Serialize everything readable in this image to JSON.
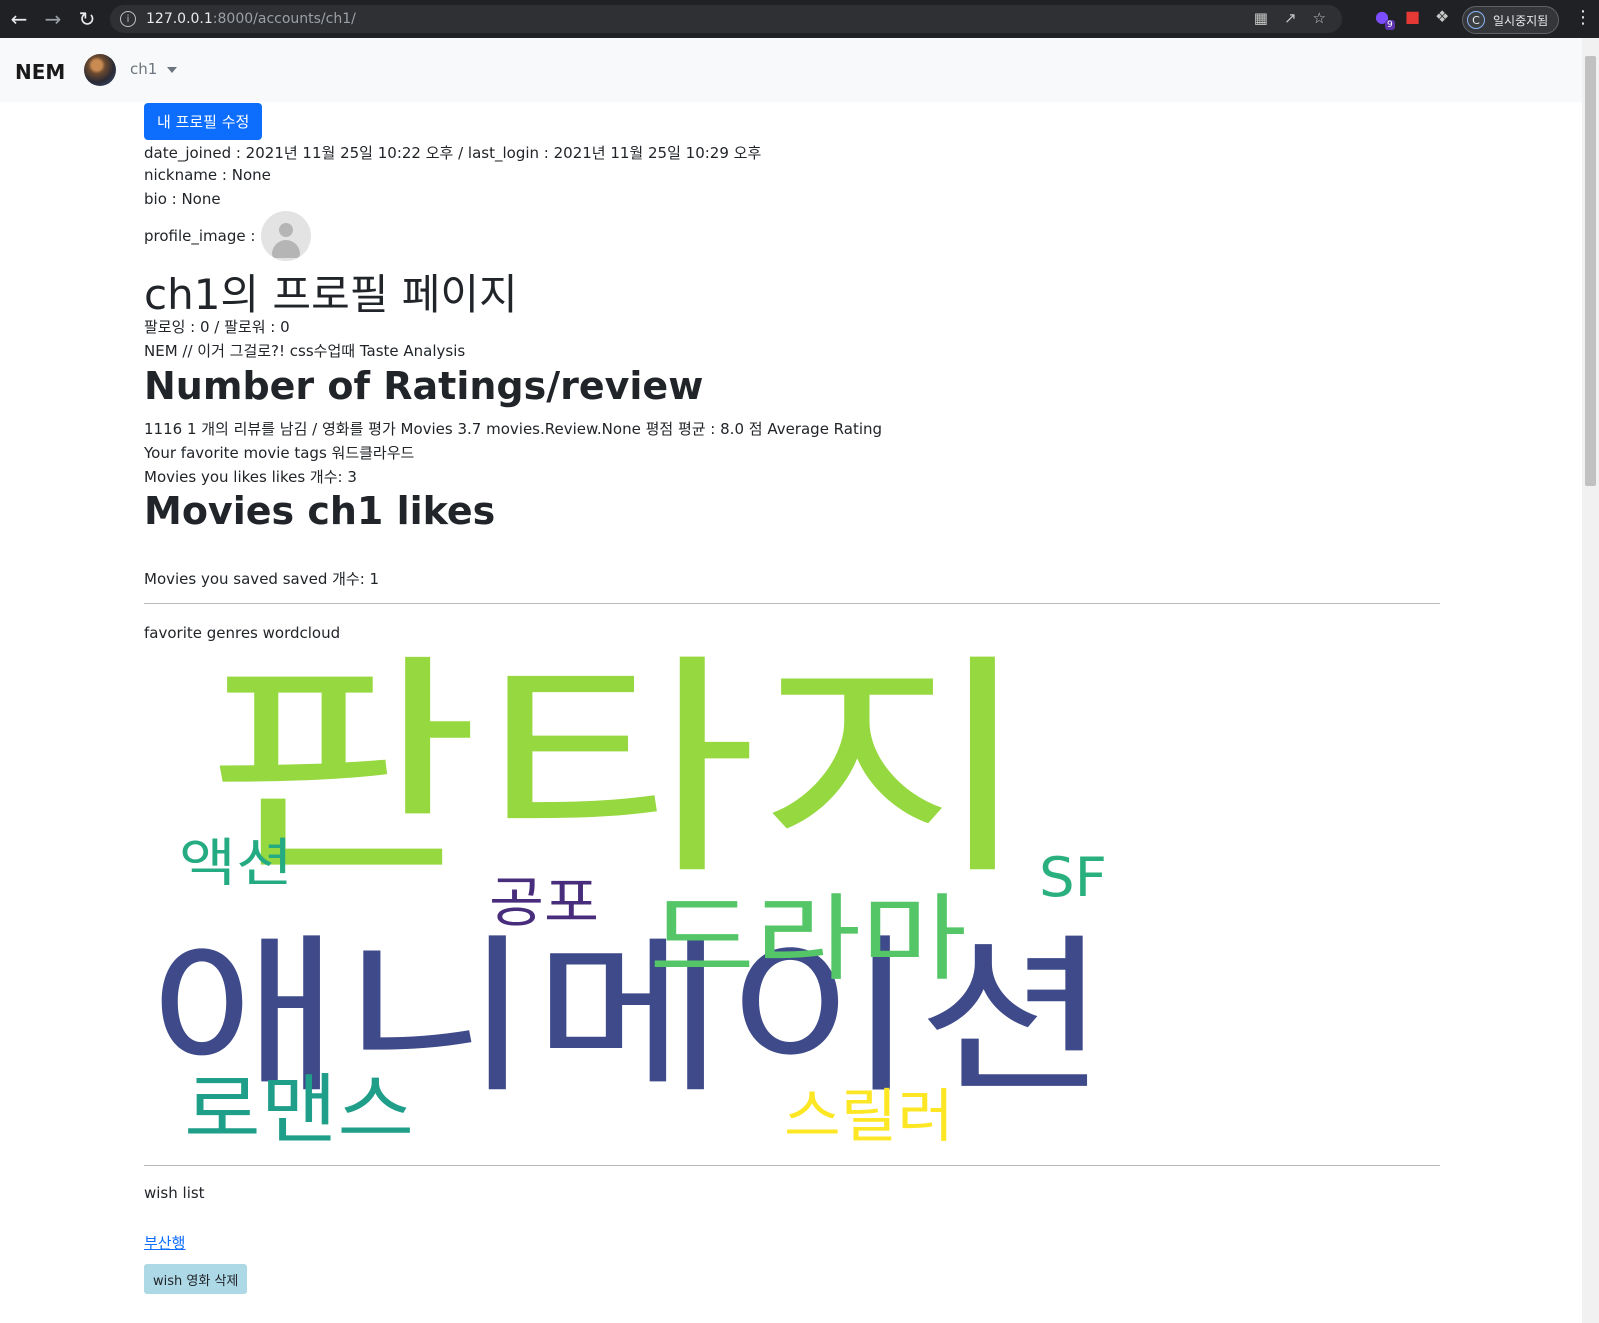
{
  "browser": {
    "url_host": "127.0.0.1",
    "url_rest": ":8000/accounts/ch1/",
    "profile_initial": "C",
    "profile_label": "일시중지됨",
    "extension_badge": "9"
  },
  "navbar": {
    "brand": "NEM",
    "username": "ch1"
  },
  "profile": {
    "edit_button": "내 프로필 수정",
    "dates_line": "date_joined : 2021년 11월 25일 10:22 오후 / last_login : 2021년 11월 25일 10:29 오후",
    "nickname_line": "nickname : None",
    "bio_line": "bio : None",
    "profile_image_label": "profile_image :",
    "page_title": "ch1의 프로필 페이지",
    "follow_line": "팔로잉 : 0 / 팔로워 : 0",
    "taste_line": "NEM // 이거 그걸로?! css수업때 Taste Analysis",
    "ratings_heading": "Number of Ratings/review",
    "ratings_line": "1116 1 개의 리뷰를 남김 / 영화를 평가 Movies 3.7 movies.Review.None 평점 평균 : 8.0 점 Average Rating",
    "tags_line": "Your favorite movie tags 워드클라우드",
    "likes_count_line": "Movies you likes likes 개수: 3",
    "likes_heading": "Movies ch1 likes",
    "saved_line": "Movies you saved saved 개수: 1",
    "wordcloud_label": "favorite genres wordcloud",
    "wish_label": "wish list",
    "wish_item": "부산행",
    "wish_delete_button": "wish 영화 삭제"
  },
  "wordcloud": {
    "words": [
      {
        "text": "판타지",
        "color": "#96d83f"
      },
      {
        "text": "애니메이션",
        "color": "#3e4a89"
      },
      {
        "text": "드라마",
        "color": "#55c667"
      },
      {
        "text": "로맨스",
        "color": "#1f9e89"
      },
      {
        "text": "액션",
        "color": "#25ab82"
      },
      {
        "text": "공포",
        "color": "#472d7b"
      },
      {
        "text": "SF",
        "color": "#2ab07f"
      },
      {
        "text": "스릴러",
        "color": "#fde725"
      }
    ]
  },
  "colors": {
    "primary": "#0d6efd",
    "info": "#add8e6",
    "navbar_bg": "#f8f9fa"
  }
}
